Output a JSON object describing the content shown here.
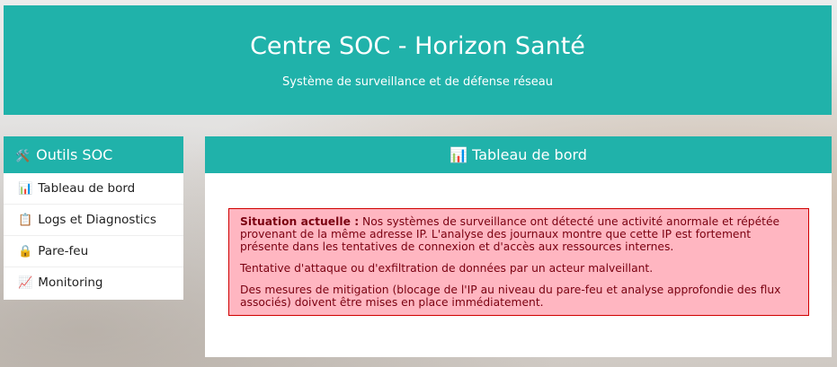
{
  "header": {
    "title": "Centre SOC - Horizon Santé",
    "subtitle": "Système de surveillance et de défense réseau"
  },
  "sidebar": {
    "title_icon": "🛠️",
    "title": "Outils SOC",
    "items": [
      {
        "icon": "📊",
        "label": "Tableau de bord"
      },
      {
        "icon": "📋",
        "label": "Logs et Diagnostics"
      },
      {
        "icon": "🔒",
        "label": "Pare-feu"
      },
      {
        "icon": "📈",
        "label": "Monitoring"
      }
    ]
  },
  "main": {
    "title_icon": "📊",
    "title": "Tableau de bord",
    "alert": {
      "label": "Situation actuelle :",
      "p1": "Nos systèmes de surveillance ont détecté une activité anormale et répétée provenant de la même adresse IP. L'analyse des journaux montre que cette IP est fortement présente dans les tentatives de connexion et d'accès aux ressources internes.",
      "p2": "Tentative d'attaque ou d'exfiltration de données par un acteur malveillant.",
      "p3": "Des mesures de mitigation (blocage de l'IP au niveau du pare-feu et analyse approfondie des flux associés) doivent être mises en place immédiatement."
    }
  },
  "colors": {
    "accent": "#20b2aa",
    "alert_bg": "#ffb6c1",
    "alert_border": "#d00000"
  }
}
